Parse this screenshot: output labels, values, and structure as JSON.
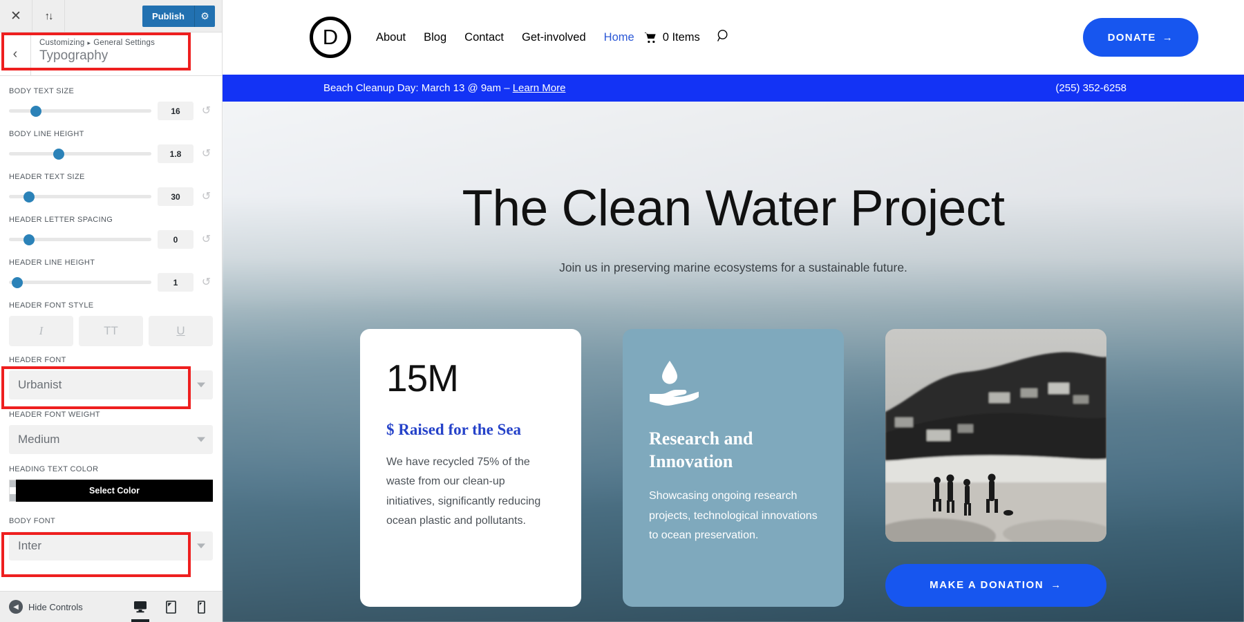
{
  "customizer": {
    "topbar": {
      "close_label": "✕",
      "devices_toggle_label": "↑↓",
      "publish_label": "Publish",
      "gear_label": "⚙"
    },
    "panel": {
      "back_label": "‹",
      "breadcrumb_root": "Customizing",
      "breadcrumb_sep": "▸",
      "breadcrumb_parent": "General Settings",
      "title": "Typography"
    },
    "controls": [
      {
        "type": "slider",
        "label": "BODY TEXT SIZE",
        "value": "16",
        "knob_pct": 19,
        "reset_label": "↺"
      },
      {
        "type": "slider",
        "label": "BODY LINE HEIGHT",
        "value": "1.8",
        "knob_pct": 35,
        "reset_label": "↺"
      },
      {
        "type": "slider",
        "label": "HEADER TEXT SIZE",
        "value": "30",
        "knob_pct": 14,
        "reset_label": "↺"
      },
      {
        "type": "slider",
        "label": "HEADER LETTER SPACING",
        "value": "0",
        "knob_pct": 14,
        "reset_label": "↺"
      },
      {
        "type": "slider",
        "label": "HEADER LINE HEIGHT",
        "value": "1",
        "knob_pct": 6,
        "reset_label": "↺"
      }
    ],
    "font_style": {
      "label": "HEADER FONT STYLE",
      "buttons": [
        {
          "name": "italic",
          "glyph": "I"
        },
        {
          "name": "uppercase",
          "glyph": "TT"
        },
        {
          "name": "underline",
          "glyph": "U"
        }
      ]
    },
    "header_font": {
      "label": "HEADER FONT",
      "value": "Urbanist"
    },
    "header_font_weight": {
      "label": "HEADER FONT WEIGHT",
      "value": "Medium"
    },
    "heading_text_color": {
      "label": "HEADING TEXT COLOR",
      "button_label": "Select Color",
      "color": "#000000"
    },
    "body_font": {
      "label": "BODY FONT",
      "value": "Inter"
    },
    "bottom": {
      "hide_controls_label": "Hide Controls",
      "hide_arrow": "◀",
      "devices": [
        {
          "name": "desktop",
          "active": true
        },
        {
          "name": "tablet",
          "active": false
        },
        {
          "name": "mobile",
          "active": false
        }
      ]
    },
    "highlight_color": "#ee1f1f"
  },
  "site": {
    "logo_letter": "D",
    "nav": [
      {
        "label": "About",
        "current": false
      },
      {
        "label": "Blog",
        "current": false
      },
      {
        "label": "Contact",
        "current": false
      },
      {
        "label": "Get-involved",
        "current": false
      },
      {
        "label": "Home",
        "current": true
      }
    ],
    "cart_label": "0 Items",
    "donate_label": "DONATE",
    "donate_arrow": "→",
    "notice": {
      "text": "Beach Cleanup Day: March 13 @ 9am – ",
      "link_label": "Learn More",
      "phone": "(255) 352-6258",
      "bg": "#1333f5"
    },
    "hero": {
      "title": "The Clean Water Project",
      "subtitle": "Join us in preserving marine ecosystems for a sustainable future."
    },
    "cards": [
      {
        "style": "white",
        "stat": "15M",
        "kicker": "$ Raised for the Sea",
        "body": "We have recycled 75% of the waste from our clean-up initiatives, significantly reducing ocean plastic and pollutants."
      },
      {
        "style": "teal",
        "icon": "water-drop-hand-icon",
        "title": "Research and Innovation",
        "body": "Showcasing ongoing research projects, technological innovations to ocean preservation.",
        "bg": "#7fa9bd"
      },
      {
        "style": "photo",
        "image_alt": "black-and-white beach with people and hillside houses",
        "cta_label": "MAKE A DONATION",
        "cta_arrow": "→",
        "cta_color": "#1756ef"
      }
    ]
  }
}
